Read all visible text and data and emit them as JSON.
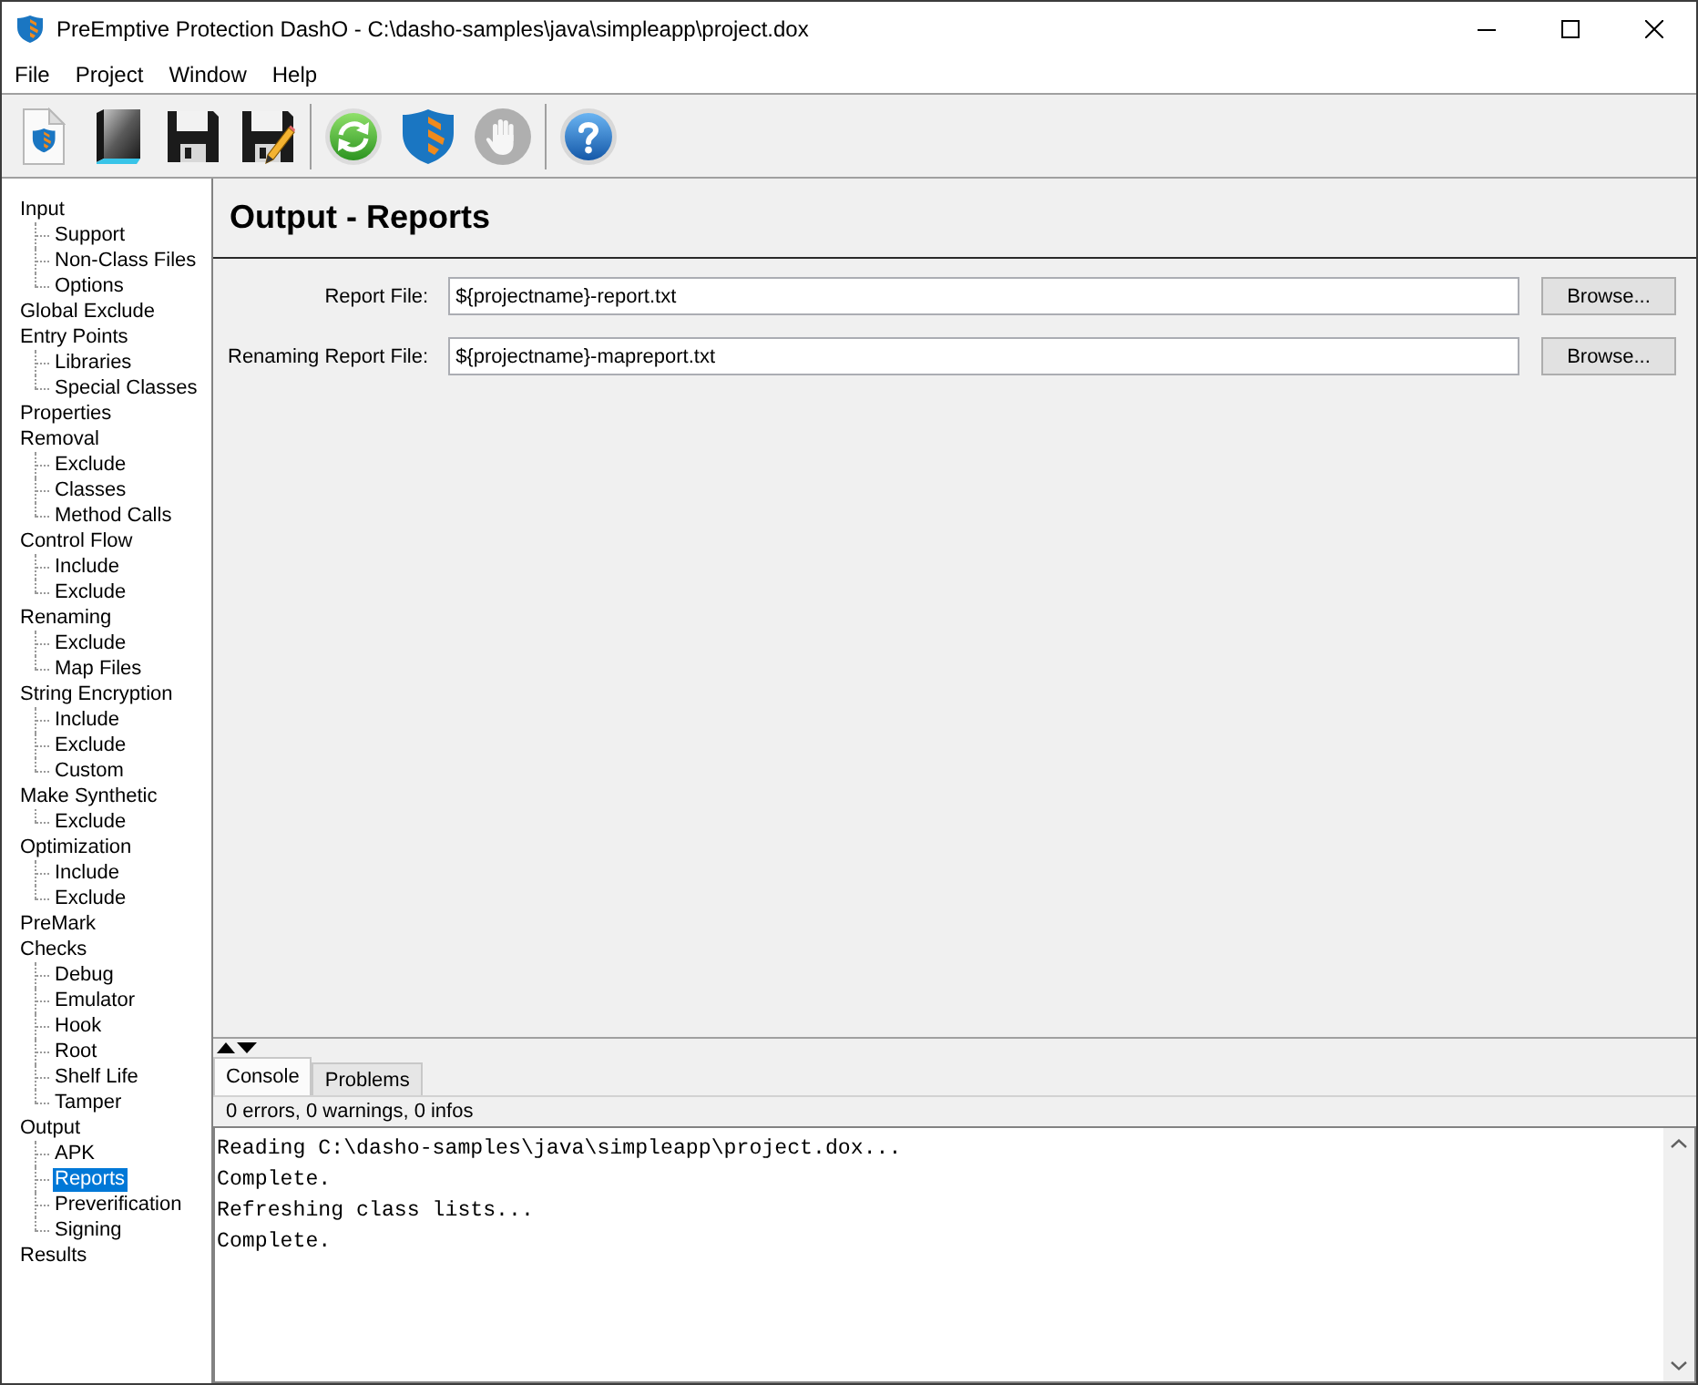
{
  "window": {
    "title": "PreEmptive Protection DashO - C:\\dasho-samples\\java\\simpleapp\\project.dox"
  },
  "menu": [
    "File",
    "Project",
    "Window",
    "Help"
  ],
  "toolbar": [
    {
      "items": [
        {
          "kind": "document",
          "disabled": false
        },
        {
          "kind": "folder",
          "disabled": false
        },
        {
          "kind": "floppy",
          "disabled": false
        },
        {
          "kind": "floppy_pencil",
          "disabled": false
        }
      ]
    },
    {
      "items": [
        {
          "kind": "refresh",
          "disabled": false
        },
        {
          "kind": "shield",
          "disabled": false
        },
        {
          "kind": "hand",
          "disabled": true
        }
      ]
    },
    {
      "items": [
        {
          "kind": "help",
          "disabled": false
        }
      ]
    }
  ],
  "sidebar": {
    "items": [
      {
        "label": "Input",
        "selected": false,
        "children": [
          {
            "label": "Support",
            "selected": false
          },
          {
            "label": "Non-Class Files",
            "selected": false
          },
          {
            "label": "Options",
            "selected": false
          }
        ]
      },
      {
        "label": "Global Exclude",
        "selected": false
      },
      {
        "label": "Entry Points",
        "selected": false,
        "children": [
          {
            "label": "Libraries",
            "selected": false
          },
          {
            "label": "Special Classes",
            "selected": false
          }
        ]
      },
      {
        "label": "Properties",
        "selected": false
      },
      {
        "label": "Removal",
        "selected": false,
        "children": [
          {
            "label": "Exclude",
            "selected": false
          },
          {
            "label": "Classes",
            "selected": false
          },
          {
            "label": "Method Calls",
            "selected": false
          }
        ]
      },
      {
        "label": "Control Flow",
        "selected": false,
        "children": [
          {
            "label": "Include",
            "selected": false
          },
          {
            "label": "Exclude",
            "selected": false
          }
        ]
      },
      {
        "label": "Renaming",
        "selected": false,
        "children": [
          {
            "label": "Exclude",
            "selected": false
          },
          {
            "label": "Map Files",
            "selected": false
          }
        ]
      },
      {
        "label": "String Encryption",
        "selected": false,
        "children": [
          {
            "label": "Include",
            "selected": false
          },
          {
            "label": "Exclude",
            "selected": false
          },
          {
            "label": "Custom",
            "selected": false
          }
        ]
      },
      {
        "label": "Make Synthetic",
        "selected": false,
        "children": [
          {
            "label": "Exclude",
            "selected": false
          }
        ]
      },
      {
        "label": "Optimization",
        "selected": false,
        "children": [
          {
            "label": "Include",
            "selected": false
          },
          {
            "label": "Exclude",
            "selected": false
          }
        ]
      },
      {
        "label": "PreMark",
        "selected": false
      },
      {
        "label": "Checks",
        "selected": false,
        "children": [
          {
            "label": "Debug",
            "selected": false
          },
          {
            "label": "Emulator",
            "selected": false
          },
          {
            "label": "Hook",
            "selected": false
          },
          {
            "label": "Root",
            "selected": false
          },
          {
            "label": "Shelf Life",
            "selected": false
          },
          {
            "label": "Tamper",
            "selected": false
          }
        ]
      },
      {
        "label": "Output",
        "selected": false,
        "children": [
          {
            "label": "APK",
            "selected": false
          },
          {
            "label": "Reports",
            "selected": true
          },
          {
            "label": "Preverification",
            "selected": false
          },
          {
            "label": "Signing",
            "selected": false
          }
        ]
      },
      {
        "label": "Results",
        "selected": false
      }
    ]
  },
  "panel": {
    "title": "Output - Reports",
    "fields": [
      {
        "label": "Report File:",
        "value": "${projectname}-report.txt",
        "button": "Browse..."
      },
      {
        "label": "Renaming Report File:",
        "value": "${projectname}-mapreport.txt",
        "button": "Browse..."
      }
    ]
  },
  "console": {
    "tabs": [
      {
        "label": "Console",
        "selected": true
      },
      {
        "label": "Problems",
        "selected": false
      }
    ],
    "status": "0 errors, 0 warnings, 0 infos",
    "lines": [
      "Reading C:\\dasho-samples\\java\\simpleapp\\project.dox...",
      "Complete.",
      "Refreshing class lists...",
      "Complete."
    ]
  }
}
